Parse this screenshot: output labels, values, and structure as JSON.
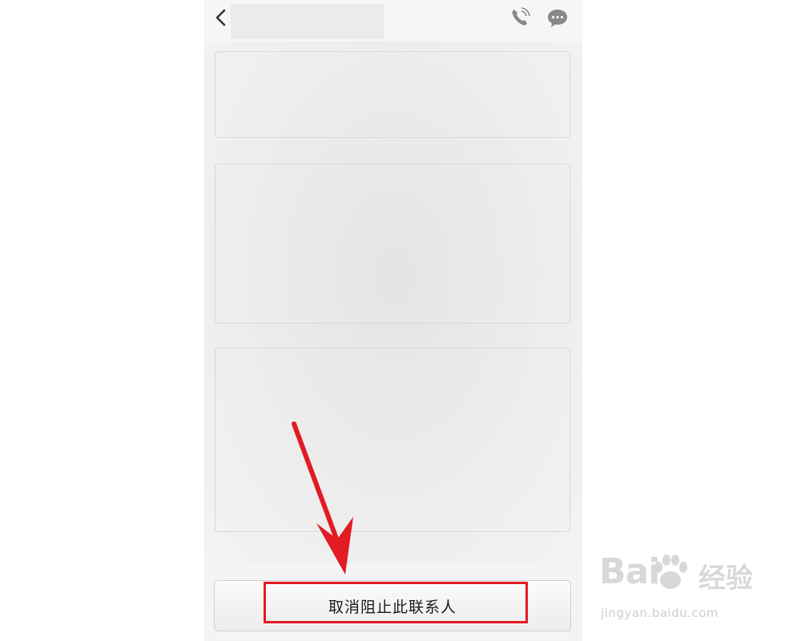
{
  "topbar": {
    "back_icon": "chevron-left-icon",
    "call_icon": "phone-call-icon",
    "message_icon": "chat-bubble-icon"
  },
  "bottom": {
    "unblock_label": "取消阻止此联系人"
  },
  "annotation": {
    "arrow_color": "#e21b24",
    "box_color": "#e21b24"
  },
  "watermark": {
    "logo": "Bai",
    "logo_suffix": "经验",
    "url": "jingyan.baidu.com"
  }
}
